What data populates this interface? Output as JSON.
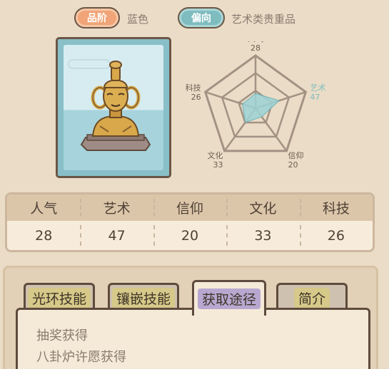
{
  "header": {
    "grade_label": "品阶",
    "grade_value": "蓝色",
    "bias_label": "偏向",
    "bias_value": "艺术类贵重品"
  },
  "item": {
    "icon": "golden-bust-icon",
    "card_color": "#88bfc8"
  },
  "radar": {
    "axes": [
      {
        "name": "人气",
        "value": 28
      },
      {
        "name": "艺术",
        "value": 47,
        "highlight": true
      },
      {
        "name": "信仰",
        "value": 20
      },
      {
        "name": "文化",
        "value": 33
      },
      {
        "name": "科技",
        "value": 26
      }
    ],
    "highlight_color": "#7fbcbf"
  },
  "stats": {
    "headers": [
      "人气",
      "艺术",
      "信仰",
      "文化",
      "科技"
    ],
    "values": [
      "28",
      "47",
      "20",
      "33",
      "26"
    ]
  },
  "tabs": [
    {
      "label": "光环技能",
      "active": false
    },
    {
      "label": "镶嵌技能",
      "active": false
    },
    {
      "label": "获取途径",
      "active": true
    },
    {
      "label": "简介",
      "active": false
    }
  ],
  "content": {
    "lines": [
      "抽奖获得",
      "八卦炉许愿获得"
    ]
  }
}
